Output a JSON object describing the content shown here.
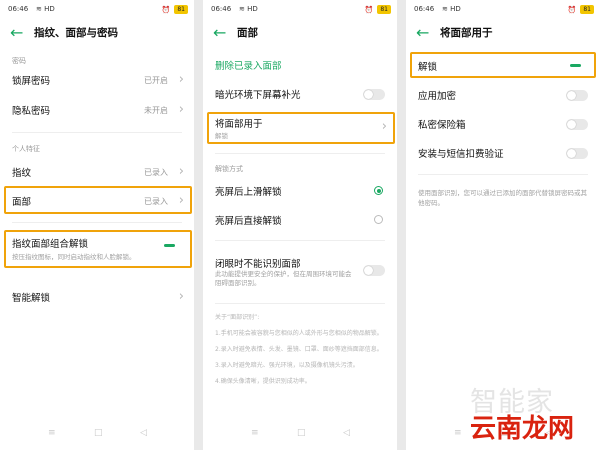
{
  "status": {
    "time": "06:46",
    "signal": "HD",
    "battery": "81"
  },
  "screens": [
    {
      "title": "指纹、面部与密码",
      "sections": {
        "password": "密码",
        "biometrics": "个人特征"
      },
      "rows": {
        "lock_password": {
          "label": "锁屏密码",
          "value": "已开启"
        },
        "privacy_password": {
          "label": "隐私密码",
          "value": "未开启"
        },
        "fingerprint": {
          "label": "指纹",
          "value": "已录入"
        },
        "face": {
          "label": "面部",
          "value": "已录入"
        },
        "combo_unlock": {
          "label": "指纹面部组合解锁",
          "sub": "按压指纹图标，同时启动指纹和人脸解锁。"
        },
        "smart_unlock": {
          "label": "智能解锁"
        }
      }
    },
    {
      "title": "面部",
      "delete_face": "删除已录入面部",
      "dim_light": "暗光环境下屏幕补光",
      "use_face_for": {
        "label": "将面部用于",
        "sub": "解锁"
      },
      "unlock_method_section": "解锁方式",
      "swipe_unlock": "亮屏后上滑解锁",
      "direct_unlock": "亮屏后直接解锁",
      "eyes_closed": {
        "label": "闭眼时不能识别面部",
        "sub": "此功能提供更安全的保护，但在周围环境可能会阻碍面部识别。"
      },
      "about_title": "关于“面部识别”:",
      "about_lines": [
        "1.手机可能会被容貌与您相似的人或外形与您相似的物品解锁。",
        "2.录入时避免表情、头发、墨镜、口罩、面纱等遮挡面部信息。",
        "3.录入时避免暗光、强光环境，以及摄像机镜头污渍。",
        "4.确保头像清晰，提供识别成功率。"
      ]
    },
    {
      "title": "将面部用于",
      "items": {
        "unlock": "解锁",
        "app_encrypt": "应用加密",
        "private_safe": "私密保险箱",
        "install_sms": "安装与短信扣费验证"
      },
      "footnote": "使用面部识别，您可以通过已添加的面部代替锁屏密码或其他密码。"
    }
  ],
  "nav": {
    "menu": "≡",
    "home": "□",
    "back": "◁"
  },
  "watermark": {
    "top": "智能家",
    "bottom": "云南龙网"
  },
  "colors": {
    "accent": "#1aa862",
    "highlight": "#f0a30a"
  },
  "icons": [
    "back-arrow-icon",
    "chevron-right-icon",
    "toggle-switch-icon",
    "radio-icon",
    "wifi-icon",
    "battery-icon"
  ]
}
